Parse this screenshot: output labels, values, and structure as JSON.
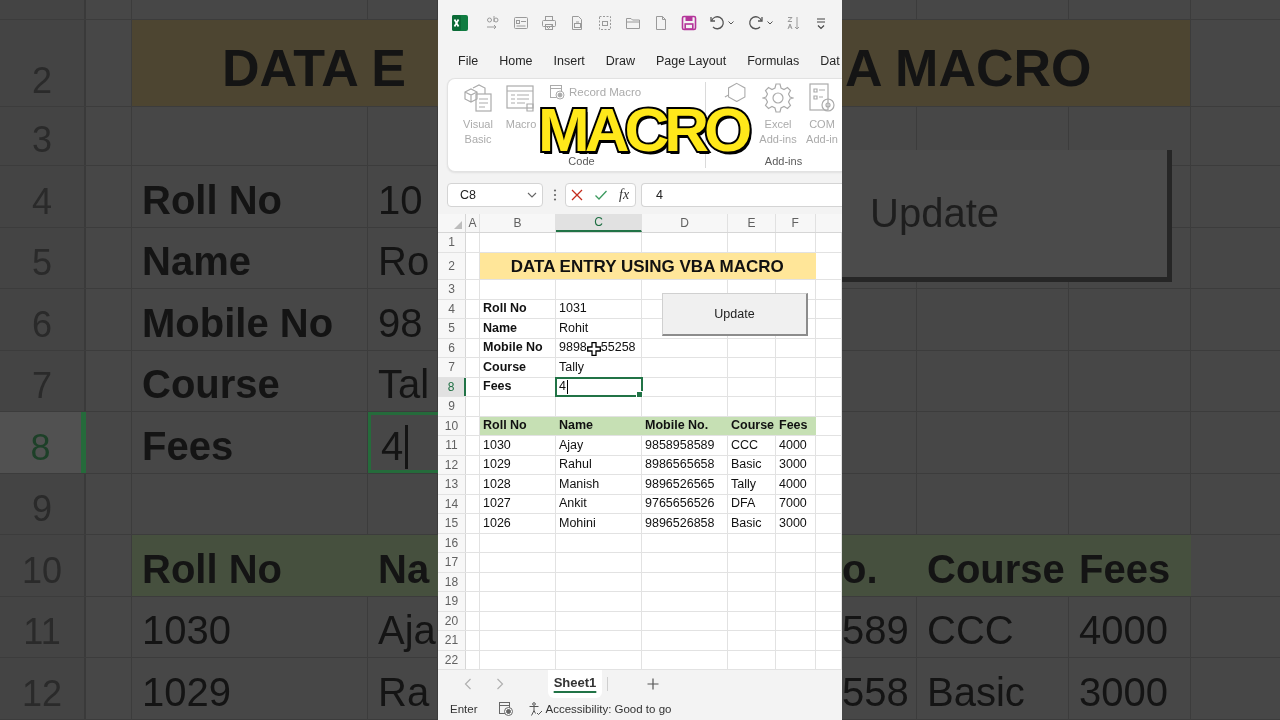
{
  "backdrop": {
    "left_rows": [
      {
        "kind": "blank",
        "selected": false,
        "active": false
      },
      {
        "kind": "title",
        "number": "2",
        "selected": false,
        "active": false,
        "label": "DATA E"
      },
      {
        "kind": "blank",
        "number": "3",
        "selected": false,
        "active": false
      },
      {
        "kind": "field",
        "number": "4",
        "selected": false,
        "active": false,
        "label": "Roll No",
        "value": "10"
      },
      {
        "kind": "field",
        "number": "5",
        "selected": false,
        "active": false,
        "label": "Name",
        "value": "Ro"
      },
      {
        "kind": "field",
        "number": "6",
        "selected": false,
        "active": false,
        "label": "Mobile No",
        "value": "98"
      },
      {
        "kind": "field",
        "number": "7",
        "selected": false,
        "active": false,
        "label": "Course",
        "value": "Tal"
      },
      {
        "kind": "field",
        "number": "8",
        "selected": true,
        "active": true,
        "label": "Fees",
        "value": "4"
      },
      {
        "kind": "blank",
        "number": "9",
        "selected": false,
        "active": false
      },
      {
        "kind": "header",
        "number": "10",
        "selected": false,
        "active": false,
        "label": "Roll No",
        "value": "Na"
      },
      {
        "kind": "data",
        "number": "11",
        "selected": false,
        "active": false,
        "label": "1030",
        "value": "Aja"
      },
      {
        "kind": "data",
        "number": "12",
        "selected": false,
        "active": false,
        "label": "1029",
        "value": "Ra"
      }
    ],
    "right_rows": [
      {
        "kind": "blank"
      },
      {
        "kind": "title",
        "cells": [
          "A MACRO"
        ]
      },
      {
        "kind": "blank"
      },
      {
        "kind": "blank"
      },
      {
        "kind": "blank"
      },
      {
        "kind": "blank"
      },
      {
        "kind": "blank"
      },
      {
        "kind": "blank"
      },
      {
        "kind": "blank"
      },
      {
        "kind": "header",
        "cells": [
          "o.",
          "Course",
          "Fees"
        ]
      },
      {
        "kind": "data",
        "cells": [
          "589",
          "CCC",
          "4000"
        ]
      },
      {
        "kind": "data",
        "cells": [
          "558",
          "Basic",
          "3000"
        ]
      }
    ],
    "button": "Update"
  },
  "ribbon": {
    "tabs": [
      {
        "label": "File",
        "selected": false
      },
      {
        "label": "Home",
        "selected": false
      },
      {
        "label": "Insert",
        "selected": false
      },
      {
        "label": "Draw",
        "selected": false
      },
      {
        "label": "Page Layout",
        "selected": false
      },
      {
        "label": "Formulas",
        "selected": false
      },
      {
        "label": "Dat",
        "selected": false
      }
    ],
    "groups": [
      {
        "label": "Code",
        "buttons": [
          {
            "kind": "large",
            "lines": [
              "Visual",
              "Basic"
            ],
            "disabled": true
          },
          {
            "kind": "large",
            "lines": [
              "Macro"
            ],
            "disabled": true
          },
          {
            "kind": "small",
            "lines": [
              "Record Macro"
            ],
            "disabled": true
          }
        ]
      },
      {
        "label": "Add-ins",
        "buttons": [
          {
            "kind": "large",
            "disabled": true
          },
          {
            "kind": "large",
            "lines": [
              "Excel",
              "Add-ins"
            ],
            "disabled": true
          },
          {
            "kind": "large",
            "lines": [
              "COM",
              "Add-in"
            ],
            "disabled": true
          }
        ]
      }
    ]
  },
  "caption": "MACRO",
  "formula_bar": {
    "name_box": "C8",
    "function_label": "fx",
    "value": "4"
  },
  "sheet": {
    "columns": [
      {
        "label": "A",
        "selected": false
      },
      {
        "label": "B",
        "selected": false
      },
      {
        "label": "C",
        "selected": true
      },
      {
        "label": "D",
        "selected": false
      },
      {
        "label": "E",
        "selected": false
      },
      {
        "label": "F",
        "selected": false
      }
    ],
    "rows": [
      {
        "number": "1",
        "kind": "blank",
        "selected": false,
        "active": false,
        "pointer": false
      },
      {
        "number": "2",
        "kind": "title",
        "selected": false,
        "active": false,
        "pointer": false,
        "cells": [
          "DATA ENTRY USING VBA MACRO"
        ]
      },
      {
        "number": "3",
        "kind": "blank",
        "selected": false,
        "active": false,
        "pointer": false
      },
      {
        "number": "4",
        "kind": "field",
        "selected": false,
        "active": false,
        "pointer": false,
        "cells": [
          "Roll No",
          "1031"
        ]
      },
      {
        "number": "5",
        "kind": "field",
        "selected": false,
        "active": false,
        "pointer": false,
        "cells": [
          "Name",
          "Rohit"
        ]
      },
      {
        "number": "6",
        "kind": "field",
        "selected": false,
        "active": false,
        "pointer": true,
        "cells": [
          "Mobile No",
          "9898",
          "55258"
        ]
      },
      {
        "number": "7",
        "kind": "field",
        "selected": false,
        "active": false,
        "pointer": false,
        "cells": [
          "Course",
          "Tally"
        ]
      },
      {
        "number": "8",
        "kind": "field",
        "selected": true,
        "active": true,
        "pointer": false,
        "cells": [
          "Fees",
          "4"
        ]
      },
      {
        "number": "9",
        "kind": "blank",
        "selected": false,
        "active": false,
        "pointer": false
      },
      {
        "number": "10",
        "kind": "header",
        "selected": false,
        "active": false,
        "pointer": false,
        "cells": [
          "Roll No",
          "Name",
          "Mobile No.",
          "Course",
          "Fees"
        ]
      },
      {
        "number": "11",
        "kind": "data",
        "selected": false,
        "active": false,
        "pointer": false,
        "cells": [
          "1030",
          "Ajay",
          "9858958589",
          "CCC",
          "4000"
        ]
      },
      {
        "number": "12",
        "kind": "data",
        "selected": false,
        "active": false,
        "pointer": false,
        "cells": [
          "1029",
          "Rahul",
          "8986565658",
          "Basic",
          "3000"
        ]
      },
      {
        "number": "13",
        "kind": "data",
        "selected": false,
        "active": false,
        "pointer": false,
        "cells": [
          "1028",
          "Manish",
          "9896526565",
          "Tally",
          "4000"
        ]
      },
      {
        "number": "14",
        "kind": "data",
        "selected": false,
        "active": false,
        "pointer": false,
        "cells": [
          "1027",
          "Ankit",
          "9765656526",
          "DFA",
          "7000"
        ]
      },
      {
        "number": "15",
        "kind": "data",
        "selected": false,
        "active": false,
        "pointer": false,
        "cells": [
          "1026",
          "Mohini",
          "9896526858",
          "Basic",
          "3000"
        ]
      },
      {
        "number": "16",
        "kind": "blank",
        "selected": false,
        "active": false,
        "pointer": false
      },
      {
        "number": "17",
        "kind": "blank",
        "selected": false,
        "active": false,
        "pointer": false
      },
      {
        "number": "18",
        "kind": "blank",
        "selected": false,
        "active": false,
        "pointer": false
      },
      {
        "number": "19",
        "kind": "blank",
        "selected": false,
        "active": false,
        "pointer": false
      },
      {
        "number": "20",
        "kind": "blank",
        "selected": false,
        "active": false,
        "pointer": false
      },
      {
        "number": "21",
        "kind": "blank",
        "selected": false,
        "active": false,
        "pointer": false
      },
      {
        "number": "22",
        "kind": "blank",
        "selected": false,
        "active": false,
        "pointer": false
      }
    ],
    "button": "Update"
  },
  "sheet_tabs": [
    {
      "label": "Sheet1",
      "selected": true
    }
  ],
  "status_bar": {
    "mode": "Enter",
    "accessibility": "Accessibility: Good to go"
  }
}
